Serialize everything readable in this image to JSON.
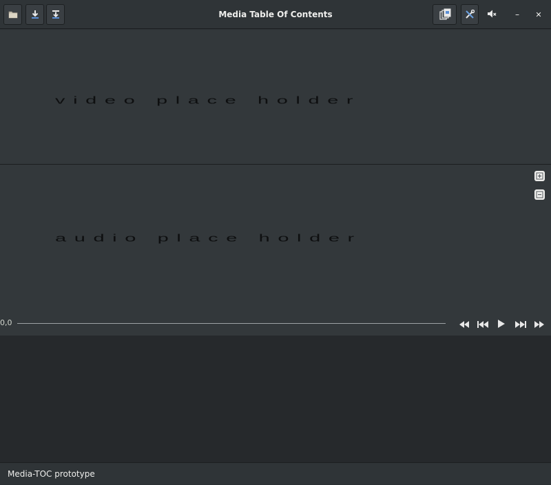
{
  "window": {
    "title": "Media Table Of Contents"
  },
  "header": {
    "left_buttons": [
      {
        "name": "open-button",
        "icon": "folder-icon"
      },
      {
        "name": "download-button",
        "icon": "download-icon"
      },
      {
        "name": "import-button",
        "icon": "import-icon"
      }
    ],
    "right_buttons": [
      {
        "name": "pages-button",
        "icon": "pages-copy-icon"
      },
      {
        "name": "tools-button",
        "icon": "tools-icon"
      },
      {
        "name": "mute-button",
        "icon": "speaker-muted-icon"
      }
    ],
    "window_controls": {
      "minimize_label": "–",
      "close_label": "✕"
    }
  },
  "video": {
    "placeholder": "video place holder"
  },
  "audio": {
    "placeholder": "audio place holder",
    "side_tools": [
      {
        "name": "zoom-in-button",
        "icon": "zoom-in-icon"
      },
      {
        "name": "zoom-out-button",
        "icon": "zoom-out-icon"
      }
    ]
  },
  "transport": {
    "time": "0,0",
    "position": 0,
    "buttons": [
      {
        "name": "rewind-button",
        "icon": "rewind-icon"
      },
      {
        "name": "skip-back-button",
        "icon": "skip-back-icon"
      },
      {
        "name": "play-button",
        "icon": "play-icon"
      },
      {
        "name": "skip-forward-button",
        "icon": "skip-forward-icon"
      },
      {
        "name": "fast-forward-button",
        "icon": "fast-forward-icon"
      }
    ]
  },
  "status": {
    "text": "Media-TOC prototype"
  },
  "colors": {
    "headerbar": "#2f3437",
    "content": "#33383b",
    "lower": "#26292c",
    "text": "#eeeeec"
  }
}
